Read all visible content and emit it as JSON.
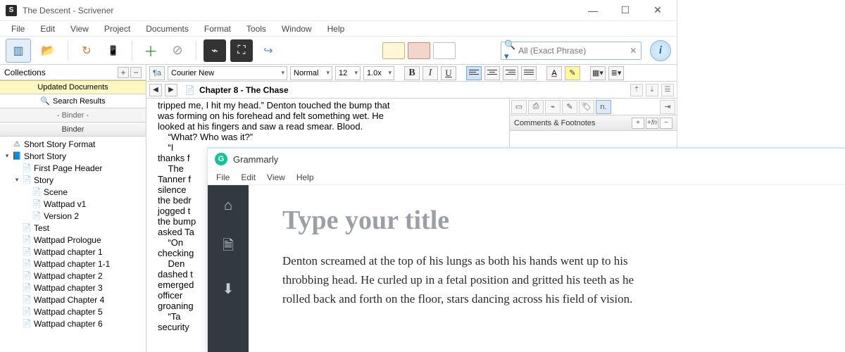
{
  "scrivener": {
    "title": "The Descent - Scrivener",
    "menu": [
      "File",
      "Edit",
      "View",
      "Project",
      "Documents",
      "Format",
      "Tools",
      "Window",
      "Help"
    ],
    "search_placeholder": "All (Exact Phrase)",
    "collections_label": "Collections",
    "tabs": {
      "updated": "Updated Documents",
      "search": "Search Results",
      "binder_sub": "- Binder -"
    },
    "binder_header": "Binder",
    "tree": [
      {
        "indent": 0,
        "arrow": "",
        "icon": "⚠",
        "iconClass": "blue",
        "label": "Short Story Format"
      },
      {
        "indent": 0,
        "arrow": "▾",
        "icon": "📘",
        "iconClass": "folder",
        "label": "Short Story"
      },
      {
        "indent": 1,
        "arrow": "",
        "icon": "📄",
        "iconClass": "page",
        "label": "First Page Header"
      },
      {
        "indent": 1,
        "arrow": "▾",
        "icon": "📄",
        "iconClass": "blue",
        "label": "Story"
      },
      {
        "indent": 2,
        "arrow": "",
        "icon": "📄",
        "iconClass": "page",
        "label": "Scene"
      },
      {
        "indent": 2,
        "arrow": "",
        "icon": "📄",
        "iconClass": "page",
        "label": "Wattpad v1"
      },
      {
        "indent": 2,
        "arrow": "",
        "icon": "📄",
        "iconClass": "page",
        "label": "Version 2"
      },
      {
        "indent": 1,
        "arrow": "",
        "icon": "📄",
        "iconClass": "page",
        "label": "Test"
      },
      {
        "indent": 1,
        "arrow": "",
        "icon": "📄",
        "iconClass": "page",
        "label": "Wattpad Prologue"
      },
      {
        "indent": 1,
        "arrow": "",
        "icon": "📄",
        "iconClass": "page",
        "label": "Wattpad chapter 1"
      },
      {
        "indent": 1,
        "arrow": "",
        "icon": "📄",
        "iconClass": "page",
        "label": "Wattpad chapter 1-1"
      },
      {
        "indent": 1,
        "arrow": "",
        "icon": "📄",
        "iconClass": "page",
        "label": "Wattpad chapter 2"
      },
      {
        "indent": 1,
        "arrow": "",
        "icon": "📄",
        "iconClass": "page",
        "label": "Wattpad chapter 3"
      },
      {
        "indent": 1,
        "arrow": "",
        "icon": "📄",
        "iconClass": "page",
        "label": "Wattpad Chapter 4"
      },
      {
        "indent": 1,
        "arrow": "",
        "icon": "📄",
        "iconClass": "page",
        "label": "Wattpad chapter 5"
      },
      {
        "indent": 1,
        "arrow": "",
        "icon": "📄",
        "iconClass": "page",
        "label": "Wattpad chapter 6"
      }
    ],
    "format_bar": {
      "font": "Courier New",
      "style": "Normal",
      "size": "12",
      "zoom": "1.0x"
    },
    "doc_header": "Chapter 8  - The Chase",
    "editor_text": "tripped me, I hit my head.” Denton touched the bump that\nwas forming on his forehead and felt something wet. He\nlooked at his fingers and saw a read smear. Blood.\n    “What? Who was it?”\n    “I\nthanks f\n    The\nTanner f\nsilence \nthe bedr\njogged t\nthe bump\nasked Ta\n    “On\nchecking\n    Den\ndashed t\nemerged \nofficer \ngroaning\n    “Ta\nsecurity",
    "inspector_header": "Comments & Footnotes"
  },
  "grammarly": {
    "title": "Grammarly",
    "menu": [
      "File",
      "Edit",
      "View",
      "Help"
    ],
    "placeholder_title": "Type your title",
    "body": "Denton screamed at the top of his lungs as both his hands went up to his throbbing head. He curled up in a fetal position and gritted his teeth as he rolled back and forth on the floor, stars dancing across his field of vision."
  }
}
